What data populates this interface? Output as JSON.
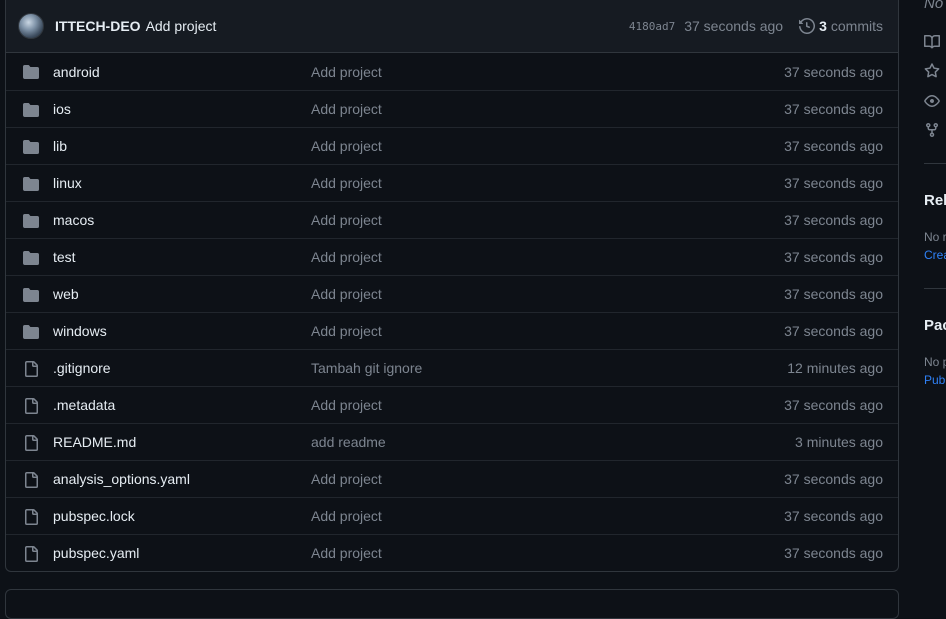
{
  "latest_commit": {
    "author": "ITTECH-DEO",
    "message": "Add project",
    "sha": "4180ad7",
    "time": "37 seconds ago",
    "commit_count": "3",
    "commits_label": "commits"
  },
  "files": [
    {
      "type": "dir",
      "name": "android",
      "message": "Add project",
      "time": "37 seconds ago"
    },
    {
      "type": "dir",
      "name": "ios",
      "message": "Add project",
      "time": "37 seconds ago"
    },
    {
      "type": "dir",
      "name": "lib",
      "message": "Add project",
      "time": "37 seconds ago"
    },
    {
      "type": "dir",
      "name": "linux",
      "message": "Add project",
      "time": "37 seconds ago"
    },
    {
      "type": "dir",
      "name": "macos",
      "message": "Add project",
      "time": "37 seconds ago"
    },
    {
      "type": "dir",
      "name": "test",
      "message": "Add project",
      "time": "37 seconds ago"
    },
    {
      "type": "dir",
      "name": "web",
      "message": "Add project",
      "time": "37 seconds ago"
    },
    {
      "type": "dir",
      "name": "windows",
      "message": "Add project",
      "time": "37 seconds ago"
    },
    {
      "type": "file",
      "name": ".gitignore",
      "message": "Tambah git ignore",
      "time": "12 minutes ago"
    },
    {
      "type": "file",
      "name": ".metadata",
      "message": "Add project",
      "time": "37 seconds ago"
    },
    {
      "type": "file",
      "name": "README.md",
      "message": "add readme",
      "time": "3 minutes ago"
    },
    {
      "type": "file",
      "name": "analysis_options.yaml",
      "message": "Add project",
      "time": "37 seconds ago"
    },
    {
      "type": "file",
      "name": "pubspec.lock",
      "message": "Add project",
      "time": "37 seconds ago"
    },
    {
      "type": "file",
      "name": "pubspec.yaml",
      "message": "Add project",
      "time": "37 seconds ago"
    }
  ],
  "sidebar": {
    "top_text": "No",
    "icons": [
      "book-icon",
      "star-icon",
      "eye-icon",
      "fork-icon"
    ],
    "releases_heading": "Rel",
    "releases_text": "No r",
    "releases_link": "Crea",
    "packages_heading": "Pac",
    "packages_text": "No p",
    "packages_link": "Pub"
  },
  "colors": {
    "background": "#0d1117",
    "header_bg": "#161b22",
    "border": "#30363d",
    "text": "#e6edf3",
    "muted": "#7d8590",
    "icon": "#7d8590",
    "link": "#2f81f7"
  }
}
